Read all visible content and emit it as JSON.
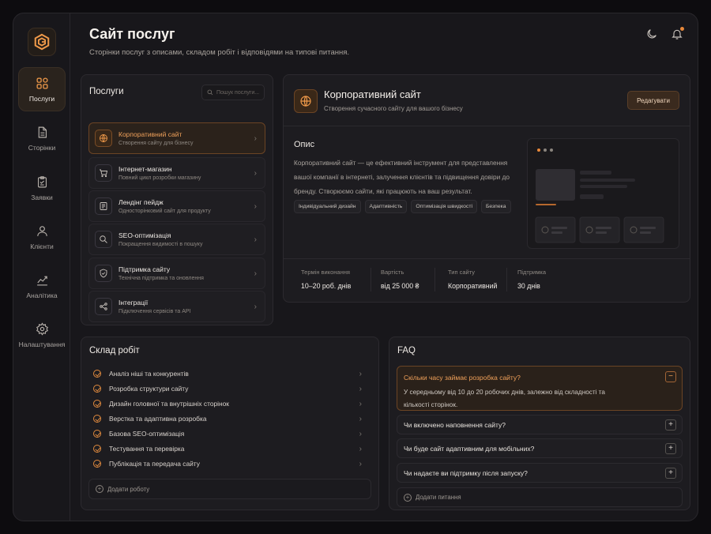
{
  "header": {
    "title": "Сайт послуг",
    "subtitle": "Сторінки послуг з описами, складом робіт і відповідями на типові питання."
  },
  "sidebar": {
    "items": [
      {
        "label": "Послуги",
        "icon": "grid-icon",
        "active": true
      },
      {
        "label": "Сторінки",
        "icon": "document-icon"
      },
      {
        "label": "Заявки",
        "icon": "clipboard-icon"
      },
      {
        "label": "Клієнти",
        "icon": "user-icon"
      },
      {
        "label": "Аналітика",
        "icon": "chart-icon"
      },
      {
        "label": "Налаштування",
        "icon": "gear-icon"
      }
    ]
  },
  "services": {
    "title": "Послуги",
    "search_placeholder": "Пошук послуги...",
    "items": [
      {
        "name": "Корпоративний сайт",
        "desc": "Створення сайту для бізнесу",
        "icon": "globe-icon",
        "active": true
      },
      {
        "name": "Інтернет-магазин",
        "desc": "Повний цикл розробки магазину",
        "icon": "cart-icon"
      },
      {
        "name": "Лендінг пейдж",
        "desc": "Односторінковий сайт для продукту",
        "icon": "page-icon"
      },
      {
        "name": "SEO-оптимізація",
        "desc": "Покращення видимості в пошуку",
        "icon": "search-icon"
      },
      {
        "name": "Підтримка сайту",
        "desc": "Технічна підтримка та оновлення",
        "icon": "shield-icon"
      },
      {
        "name": "Інтеграції",
        "desc": "Підключення сервісів та API",
        "icon": "share-icon"
      }
    ]
  },
  "detail": {
    "title": "Корпоративний сайт",
    "subtitle": "Створення сучасного сайту для вашого бізнесу",
    "edit_label": "Редагувати",
    "desc_label": "Опис",
    "description": "Корпоративний сайт — це ефективний інструмент для представлення вашої компанії в інтернеті, залучення клієнтів та підвищення довіри до бренду. Створюємо сайти, які працюють на ваш результат.",
    "tags": [
      "Індивідуальний дизайн",
      "Адаптивність",
      "Оптимізація швидкості",
      "Безпека"
    ],
    "stats": [
      {
        "label": "Термін виконання",
        "value": "10–20 роб. днів"
      },
      {
        "label": "Вартість",
        "value": "від 25 000 ₴"
      },
      {
        "label": "Тип сайту",
        "value": "Корпоративний"
      },
      {
        "label": "Підтримка",
        "value": "30 днів"
      }
    ]
  },
  "works": {
    "title": "Склад робіт",
    "items": [
      "Аналіз ніші та конкурентів",
      "Розробка структури сайту",
      "Дизайн головної та внутрішніх сторінок",
      "Верстка та адаптивна розробка",
      "Базова SEO-оптимізація",
      "Тестування та перевірка",
      "Публікація та передача сайту"
    ],
    "add_label": "Додати роботу"
  },
  "faq": {
    "title": "FAQ",
    "items": [
      {
        "q": "Скільки часу займає розробка сайту?",
        "a": "У середньому від 10 до 20 робочих днів, залежно від складності та кількості сторінок.",
        "open": true
      },
      {
        "q": "Чи включено наповнення сайту?"
      },
      {
        "q": "Чи буде сайт адаптивним для мобільних?"
      },
      {
        "q": "Чи надаєте ви підтримку після запуску?"
      }
    ],
    "add_label": "Додати питання"
  },
  "colors": {
    "accent": "#e8883a",
    "background": "#18171b",
    "panel": "#1d1c20"
  }
}
